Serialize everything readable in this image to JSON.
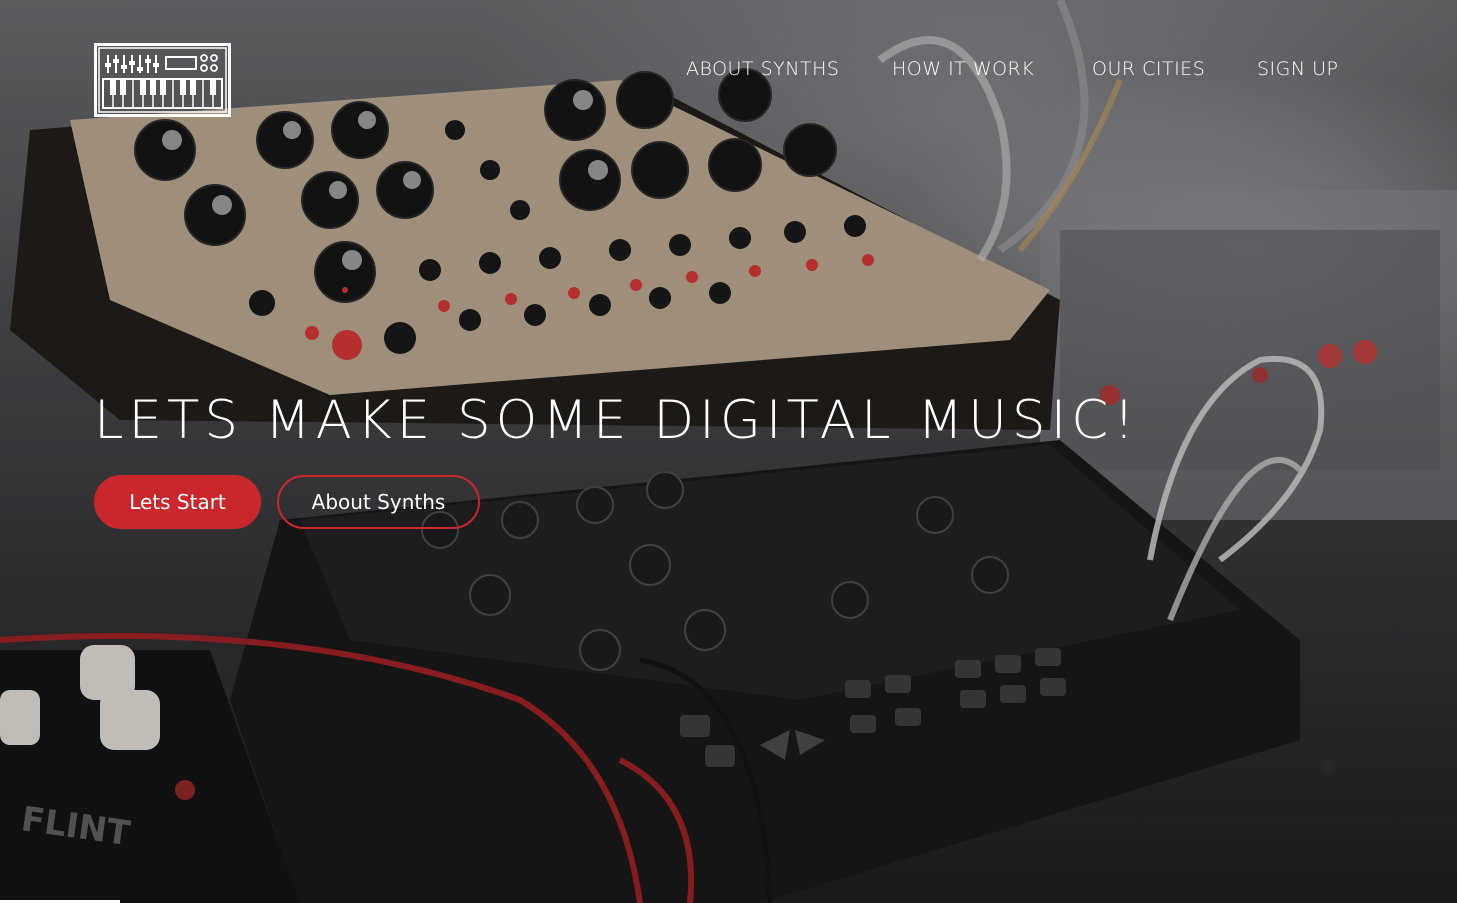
{
  "logo": {
    "icon": "synthesizer-keyboard-icon"
  },
  "nav": {
    "items": [
      {
        "label": "ABOUT SYNTHS"
      },
      {
        "label": "HOW IT WORK"
      },
      {
        "label": "OUR CITIES"
      },
      {
        "label": "SIGN UP"
      }
    ]
  },
  "hero": {
    "headline": "LETS MAKE SOME DIGITAL MUSIC!",
    "primary_button": "Lets Start",
    "secondary_button": "About Synths"
  },
  "colors": {
    "accent": "#c9272b",
    "text": "#ffffff",
    "background_dark": "#1c1c1f"
  }
}
